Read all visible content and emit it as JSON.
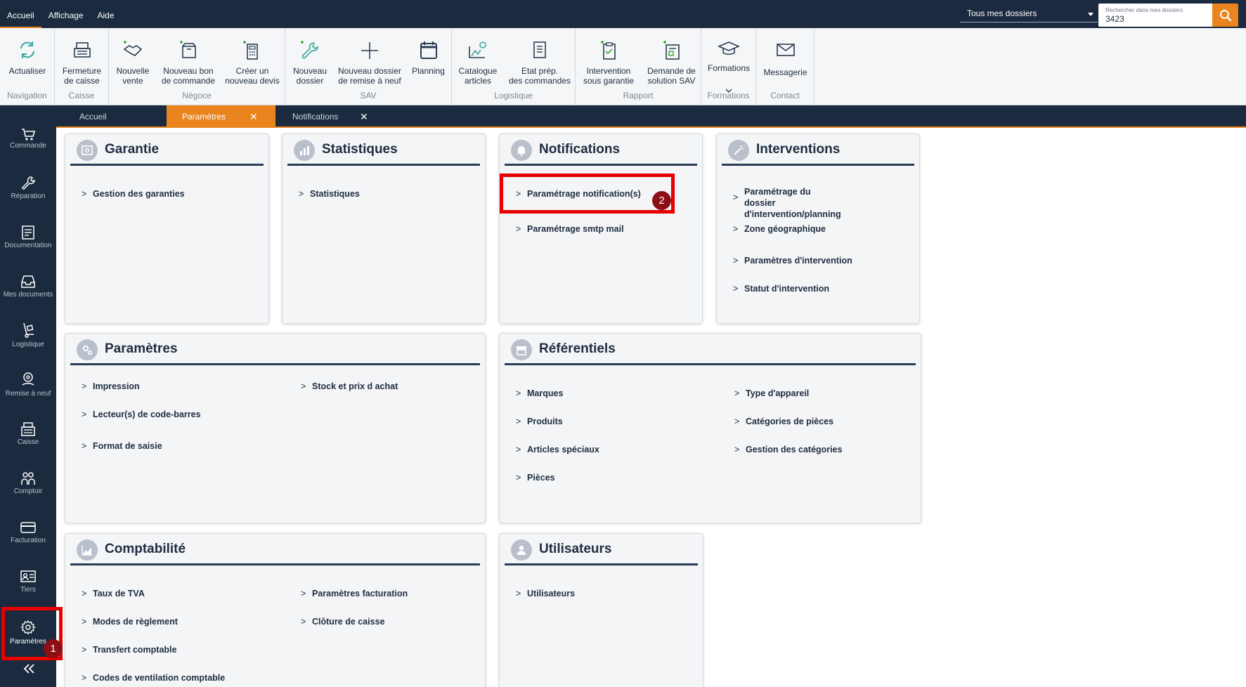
{
  "menu": {
    "items": [
      "Accueil",
      "Affichage",
      "Aide"
    ]
  },
  "search": {
    "scope": "Tous mes dossiers",
    "placeholder": "Rechercher dans mes dossiers",
    "value": "3423"
  },
  "ribbon": {
    "groups": [
      {
        "label": "Navigation",
        "buttons": [
          {
            "label": "Actualiser",
            "icon": "refresh-icon"
          }
        ]
      },
      {
        "label": "Caisse",
        "buttons": [
          {
            "label": "Fermeture\nde caisse",
            "icon": "cash-register-icon"
          }
        ]
      },
      {
        "label": "Négoce",
        "buttons": [
          {
            "label": "Nouvelle\nvente",
            "icon": "handshake-plus-icon"
          },
          {
            "label": "Nouveau bon\nde commande",
            "icon": "box-plus-icon"
          },
          {
            "label": "Créer un\nnouveau devis",
            "icon": "calculator-plus-icon"
          }
        ]
      },
      {
        "label": "SAV",
        "buttons": [
          {
            "label": "Nouveau\ndossier",
            "icon": "wrench-plus-icon"
          },
          {
            "label": "Nouveau dossier\nde remise à neuf",
            "icon": "plus-icon"
          },
          {
            "label": "Planning",
            "icon": "calendar-icon"
          }
        ]
      },
      {
        "label": "Logistique",
        "buttons": [
          {
            "label": "Catalogue\narticles",
            "icon": "catalog-gear-icon"
          },
          {
            "label": "Etat prép.\ndes commandes",
            "icon": "checklist-icon"
          }
        ]
      },
      {
        "label": "Rapport",
        "buttons": [
          {
            "label": "Intervention\nsous garantie",
            "icon": "clipboard-plus-icon"
          },
          {
            "label": "Demande de\nsolution SAV",
            "icon": "form-plus-icon"
          }
        ]
      },
      {
        "label": "Formations",
        "buttons": [
          {
            "label": "Formations",
            "icon": "graduation-cap-icon"
          }
        ]
      },
      {
        "label": "Contact",
        "buttons": [
          {
            "label": "Messagerie",
            "icon": "envelope-icon"
          }
        ]
      }
    ]
  },
  "tabs": [
    {
      "label": "Accueil",
      "closable": false
    },
    {
      "label": "Paramètres",
      "closable": true
    },
    {
      "label": "Notifications",
      "closable": true
    }
  ],
  "sidebar": {
    "items": [
      {
        "label": "Commande",
        "icon": "cart-icon"
      },
      {
        "label": "Réparation",
        "icon": "wrench-icon"
      },
      {
        "label": "Documentation",
        "icon": "document-icon"
      },
      {
        "label": "Mes documents",
        "icon": "inbox-icon"
      },
      {
        "label": "Logistique",
        "icon": "hand-truck-icon"
      },
      {
        "label": "Remise à neuf",
        "icon": "refurbish-icon"
      },
      {
        "label": "Caisse",
        "icon": "cash-register-icon"
      },
      {
        "label": "Comptoir",
        "icon": "people-icon"
      },
      {
        "label": "Facturation",
        "icon": "credit-card-icon"
      },
      {
        "label": "Tiers",
        "icon": "id-card-icon"
      },
      {
        "label": "Paramètres",
        "icon": "gear-icon"
      }
    ],
    "collapse_icon": "double-chevron-left-icon"
  },
  "cards": {
    "garantie": {
      "title": "Garantie",
      "icon": "safe-icon",
      "links": [
        "Gestion des garanties"
      ]
    },
    "statistiques": {
      "title": "Statistiques",
      "icon": "bar-chart-icon",
      "links": [
        "Statistiques"
      ]
    },
    "notifications": {
      "title": "Notifications",
      "icon": "bell-icon",
      "links": [
        "Paramétrage notification(s)",
        "Paramétrage smtp mail"
      ]
    },
    "interventions": {
      "title": "Interventions",
      "icon": "magic-wand-icon",
      "links": [
        "Paramétrage du dossier\nd'intervention/planning",
        "Zone géographique",
        "Paramètres d'intervention",
        "Statut d'intervention"
      ]
    },
    "parametres": {
      "title": "Paramètres",
      "icon": "gears-icon",
      "col1": [
        "Impression",
        "Lecteur(s) de code-barres",
        "Format de saisie"
      ],
      "col2": [
        "Stock et prix d achat"
      ]
    },
    "referentiels": {
      "title": "Référentiels",
      "icon": "store-icon",
      "col1": [
        "Marques",
        "Produits",
        "Articles spéciaux",
        "Pièces"
      ],
      "col2": [
        "Type d'appareil",
        "Catégories de pièces",
        "Gestion des catégories"
      ]
    },
    "comptabilite": {
      "title": "Comptabilité",
      "icon": "area-chart-icon",
      "col1": [
        "Taux de TVA",
        "Modes de règlement",
        "Transfert comptable",
        "Codes de ventilation comptable"
      ],
      "col2": [
        "Paramètres facturation",
        "Clôture de caisse"
      ]
    },
    "utilisateurs": {
      "title": "Utilisateurs",
      "icon": "user-icon",
      "links": [
        "Utilisateurs"
      ]
    }
  },
  "annotations": {
    "badge1": "1",
    "badge2": "2",
    "highlight_color": "#e60000",
    "badge_color": "#8d0f16"
  },
  "colors": {
    "accent": "#e9841f",
    "navy": "#1b2a3e"
  }
}
